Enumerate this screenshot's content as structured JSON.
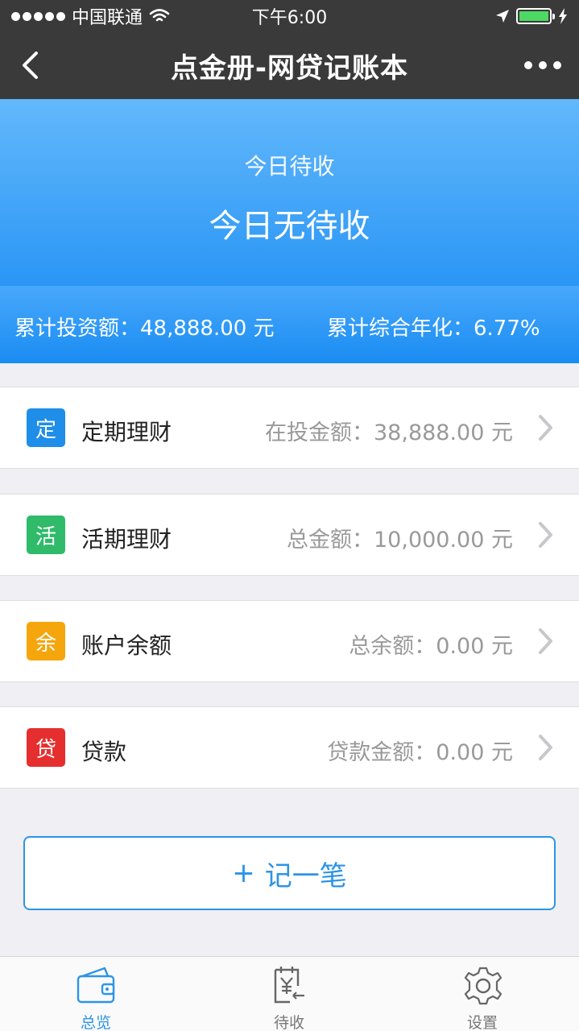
{
  "status_bar": {
    "carrier": "中国联通",
    "time": "下午6:00"
  },
  "nav": {
    "title": "点金册-网贷记账本"
  },
  "hero": {
    "label": "今日待收",
    "value": "今日无待收"
  },
  "summary": {
    "total_investment": "累计投资额：48,888.00 元",
    "annualized": "累计综合年化：6.77%"
  },
  "rows": [
    {
      "icon_char": "定",
      "icon_color": "#1e8ee9",
      "title": "定期理财",
      "value": "在投金额：38,888.00 元"
    },
    {
      "icon_char": "活",
      "icon_color": "#2fbb6a",
      "title": "活期理财",
      "value": "总金额：10,000.00 元"
    },
    {
      "icon_char": "余",
      "icon_color": "#f5a60d",
      "title": "账户余额",
      "value": "总余额：0.00 元"
    },
    {
      "icon_char": "贷",
      "icon_color": "#e52f2f",
      "title": "贷款",
      "value": "贷款金额：0.00 元"
    }
  ],
  "add_button": {
    "label": "记一笔"
  },
  "tabs": [
    {
      "label": "总览",
      "icon": "wallet-icon",
      "active": true
    },
    {
      "label": "待收",
      "icon": "receivable-icon",
      "active": false
    },
    {
      "label": "设置",
      "icon": "gear-icon",
      "active": false
    }
  ],
  "colors": {
    "accent": "#2c94e6",
    "header_bg": "#3a3a3a"
  }
}
